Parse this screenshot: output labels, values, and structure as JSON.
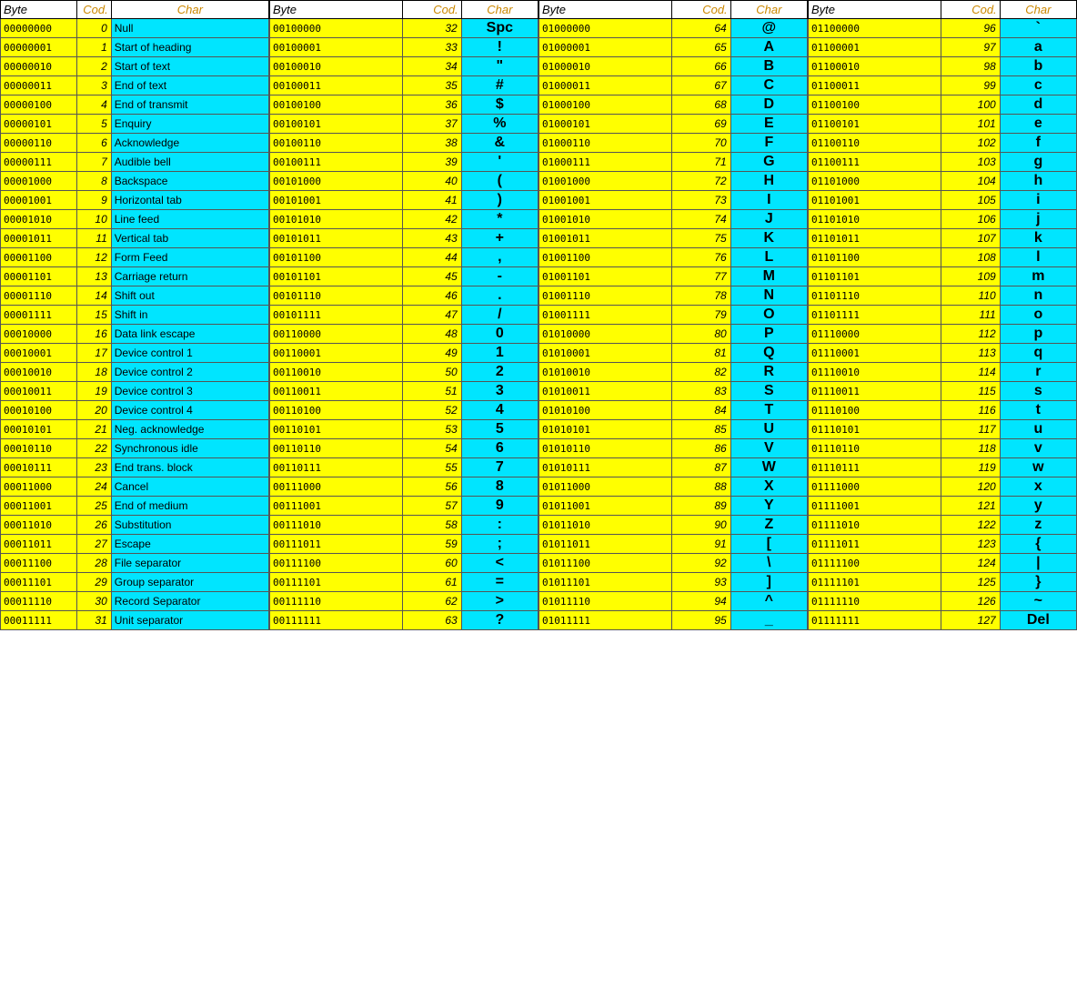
{
  "sections": [
    {
      "id": "section1",
      "headers": [
        "Byte",
        "Cod.",
        "Char"
      ],
      "rows": [
        {
          "byte": "00000000",
          "cod": "0",
          "char": "Null",
          "char_type": "desc"
        },
        {
          "byte": "00000001",
          "cod": "1",
          "char": "Start of heading",
          "char_type": "desc"
        },
        {
          "byte": "00000010",
          "cod": "2",
          "char": "Start of text",
          "char_type": "desc"
        },
        {
          "byte": "00000011",
          "cod": "3",
          "char": "End of text",
          "char_type": "desc"
        },
        {
          "byte": "00000100",
          "cod": "4",
          "char": "End of transmit",
          "char_type": "desc"
        },
        {
          "byte": "00000101",
          "cod": "5",
          "char": "Enquiry",
          "char_type": "desc"
        },
        {
          "byte": "00000110",
          "cod": "6",
          "char": "Acknowledge",
          "char_type": "desc"
        },
        {
          "byte": "00000111",
          "cod": "7",
          "char": "Audible bell",
          "char_type": "desc"
        },
        {
          "byte": "00001000",
          "cod": "8",
          "char": "Backspace",
          "char_type": "desc"
        },
        {
          "byte": "00001001",
          "cod": "9",
          "char": "Horizontal tab",
          "char_type": "desc"
        },
        {
          "byte": "00001010",
          "cod": "10",
          "char": "Line feed",
          "char_type": "desc"
        },
        {
          "byte": "00001011",
          "cod": "11",
          "char": "Vertical tab",
          "char_type": "desc"
        },
        {
          "byte": "00001100",
          "cod": "12",
          "char": "Form Feed",
          "char_type": "desc"
        },
        {
          "byte": "00001101",
          "cod": "13",
          "char": "Carriage return",
          "char_type": "desc"
        },
        {
          "byte": "00001110",
          "cod": "14",
          "char": "Shift out",
          "char_type": "desc"
        },
        {
          "byte": "00001111",
          "cod": "15",
          "char": "Shift in",
          "char_type": "desc"
        },
        {
          "byte": "00010000",
          "cod": "16",
          "char": "Data link escape",
          "char_type": "desc"
        },
        {
          "byte": "00010001",
          "cod": "17",
          "char": "Device control 1",
          "char_type": "desc"
        },
        {
          "byte": "00010010",
          "cod": "18",
          "char": "Device control 2",
          "char_type": "desc"
        },
        {
          "byte": "00010011",
          "cod": "19",
          "char": "Device control 3",
          "char_type": "desc"
        },
        {
          "byte": "00010100",
          "cod": "20",
          "char": "Device control 4",
          "char_type": "desc"
        },
        {
          "byte": "00010101",
          "cod": "21",
          "char": "Neg. acknowledge",
          "char_type": "desc"
        },
        {
          "byte": "00010110",
          "cod": "22",
          "char": "Synchronous idle",
          "char_type": "desc"
        },
        {
          "byte": "00010111",
          "cod": "23",
          "char": "End trans. block",
          "char_type": "desc"
        },
        {
          "byte": "00011000",
          "cod": "24",
          "char": "Cancel",
          "char_type": "desc"
        },
        {
          "byte": "00011001",
          "cod": "25",
          "char": "End of medium",
          "char_type": "desc"
        },
        {
          "byte": "00011010",
          "cod": "26",
          "char": "Substitution",
          "char_type": "desc"
        },
        {
          "byte": "00011011",
          "cod": "27",
          "char": "Escape",
          "char_type": "desc"
        },
        {
          "byte": "00011100",
          "cod": "28",
          "char": "File separator",
          "char_type": "desc"
        },
        {
          "byte": "00011101",
          "cod": "29",
          "char": "Group separator",
          "char_type": "desc"
        },
        {
          "byte": "00011110",
          "cod": "30",
          "char": "Record Separator",
          "char_type": "desc"
        },
        {
          "byte": "00011111",
          "cod": "31",
          "char": "Unit separator",
          "char_type": "desc"
        }
      ]
    },
    {
      "id": "section2",
      "headers": [
        "Byte",
        "Cod.",
        "Char"
      ],
      "rows": [
        {
          "byte": "00100000",
          "cod": "32",
          "char": "Spc",
          "char_type": "symbol"
        },
        {
          "byte": "00100001",
          "cod": "33",
          "char": "!",
          "char_type": "symbol"
        },
        {
          "byte": "00100010",
          "cod": "34",
          "char": "\"",
          "char_type": "symbol"
        },
        {
          "byte": "00100011",
          "cod": "35",
          "char": "#",
          "char_type": "symbol"
        },
        {
          "byte": "00100100",
          "cod": "36",
          "char": "$",
          "char_type": "symbol"
        },
        {
          "byte": "00100101",
          "cod": "37",
          "char": "%",
          "char_type": "symbol"
        },
        {
          "byte": "00100110",
          "cod": "38",
          "char": "&",
          "char_type": "symbol"
        },
        {
          "byte": "00100111",
          "cod": "39",
          "char": "'",
          "char_type": "symbol"
        },
        {
          "byte": "00101000",
          "cod": "40",
          "char": "(",
          "char_type": "symbol"
        },
        {
          "byte": "00101001",
          "cod": "41",
          "char": ")",
          "char_type": "symbol"
        },
        {
          "byte": "00101010",
          "cod": "42",
          "char": "*",
          "char_type": "symbol"
        },
        {
          "byte": "00101011",
          "cod": "43",
          "char": "+",
          "char_type": "symbol"
        },
        {
          "byte": "00101100",
          "cod": "44",
          "char": ",",
          "char_type": "symbol"
        },
        {
          "byte": "00101101",
          "cod": "45",
          "char": "-",
          "char_type": "symbol"
        },
        {
          "byte": "00101110",
          "cod": "46",
          "char": ".",
          "char_type": "symbol"
        },
        {
          "byte": "00101111",
          "cod": "47",
          "char": "/",
          "char_type": "symbol"
        },
        {
          "byte": "00110000",
          "cod": "48",
          "char": "0",
          "char_type": "symbol"
        },
        {
          "byte": "00110001",
          "cod": "49",
          "char": "1",
          "char_type": "symbol"
        },
        {
          "byte": "00110010",
          "cod": "50",
          "char": "2",
          "char_type": "symbol"
        },
        {
          "byte": "00110011",
          "cod": "51",
          "char": "3",
          "char_type": "symbol"
        },
        {
          "byte": "00110100",
          "cod": "52",
          "char": "4",
          "char_type": "symbol"
        },
        {
          "byte": "00110101",
          "cod": "53",
          "char": "5",
          "char_type": "symbol"
        },
        {
          "byte": "00110110",
          "cod": "54",
          "char": "6",
          "char_type": "symbol"
        },
        {
          "byte": "00110111",
          "cod": "55",
          "char": "7",
          "char_type": "symbol"
        },
        {
          "byte": "00111000",
          "cod": "56",
          "char": "8",
          "char_type": "symbol"
        },
        {
          "byte": "00111001",
          "cod": "57",
          "char": "9",
          "char_type": "symbol"
        },
        {
          "byte": "00111010",
          "cod": "58",
          "char": ":",
          "char_type": "symbol"
        },
        {
          "byte": "00111011",
          "cod": "59",
          "char": ";",
          "char_type": "symbol"
        },
        {
          "byte": "00111100",
          "cod": "60",
          "char": "<",
          "char_type": "symbol"
        },
        {
          "byte": "00111101",
          "cod": "61",
          "char": "=",
          "char_type": "symbol"
        },
        {
          "byte": "00111110",
          "cod": "62",
          "char": ">",
          "char_type": "symbol"
        },
        {
          "byte": "00111111",
          "cod": "63",
          "char": "?",
          "char_type": "symbol"
        }
      ]
    },
    {
      "id": "section3",
      "headers": [
        "Byte",
        "Cod.",
        "Char"
      ],
      "rows": [
        {
          "byte": "01000000",
          "cod": "64",
          "char": "@",
          "char_type": "symbol"
        },
        {
          "byte": "01000001",
          "cod": "65",
          "char": "A",
          "char_type": "symbol"
        },
        {
          "byte": "01000010",
          "cod": "66",
          "char": "B",
          "char_type": "symbol"
        },
        {
          "byte": "01000011",
          "cod": "67",
          "char": "C",
          "char_type": "symbol"
        },
        {
          "byte": "01000100",
          "cod": "68",
          "char": "D",
          "char_type": "symbol"
        },
        {
          "byte": "01000101",
          "cod": "69",
          "char": "E",
          "char_type": "symbol"
        },
        {
          "byte": "01000110",
          "cod": "70",
          "char": "F",
          "char_type": "symbol"
        },
        {
          "byte": "01000111",
          "cod": "71",
          "char": "G",
          "char_type": "symbol"
        },
        {
          "byte": "01001000",
          "cod": "72",
          "char": "H",
          "char_type": "symbol"
        },
        {
          "byte": "01001001",
          "cod": "73",
          "char": "I",
          "char_type": "symbol"
        },
        {
          "byte": "01001010",
          "cod": "74",
          "char": "J",
          "char_type": "symbol"
        },
        {
          "byte": "01001011",
          "cod": "75",
          "char": "K",
          "char_type": "symbol"
        },
        {
          "byte": "01001100",
          "cod": "76",
          "char": "L",
          "char_type": "symbol"
        },
        {
          "byte": "01001101",
          "cod": "77",
          "char": "M",
          "char_type": "symbol"
        },
        {
          "byte": "01001110",
          "cod": "78",
          "char": "N",
          "char_type": "symbol"
        },
        {
          "byte": "01001111",
          "cod": "79",
          "char": "O",
          "char_type": "symbol"
        },
        {
          "byte": "01010000",
          "cod": "80",
          "char": "P",
          "char_type": "symbol"
        },
        {
          "byte": "01010001",
          "cod": "81",
          "char": "Q",
          "char_type": "symbol"
        },
        {
          "byte": "01010010",
          "cod": "82",
          "char": "R",
          "char_type": "symbol"
        },
        {
          "byte": "01010011",
          "cod": "83",
          "char": "S",
          "char_type": "symbol"
        },
        {
          "byte": "01010100",
          "cod": "84",
          "char": "T",
          "char_type": "symbol"
        },
        {
          "byte": "01010101",
          "cod": "85",
          "char": "U",
          "char_type": "symbol"
        },
        {
          "byte": "01010110",
          "cod": "86",
          "char": "V",
          "char_type": "symbol"
        },
        {
          "byte": "01010111",
          "cod": "87",
          "char": "W",
          "char_type": "symbol"
        },
        {
          "byte": "01011000",
          "cod": "88",
          "char": "X",
          "char_type": "symbol"
        },
        {
          "byte": "01011001",
          "cod": "89",
          "char": "Y",
          "char_type": "symbol"
        },
        {
          "byte": "01011010",
          "cod": "90",
          "char": "Z",
          "char_type": "symbol"
        },
        {
          "byte": "01011011",
          "cod": "91",
          "char": "[",
          "char_type": "symbol"
        },
        {
          "byte": "01011100",
          "cod": "92",
          "char": "\\",
          "char_type": "symbol"
        },
        {
          "byte": "01011101",
          "cod": "93",
          "char": "]",
          "char_type": "symbol"
        },
        {
          "byte": "01011110",
          "cod": "94",
          "char": "^",
          "char_type": "symbol"
        },
        {
          "byte": "01011111",
          "cod": "95",
          "char": "_",
          "char_type": "symbol"
        }
      ]
    },
    {
      "id": "section4",
      "headers": [
        "Byte",
        "Cod.",
        "Char"
      ],
      "rows": [
        {
          "byte": "01100000",
          "cod": "96",
          "char": "`",
          "char_type": "symbol"
        },
        {
          "byte": "01100001",
          "cod": "97",
          "char": "a",
          "char_type": "symbol"
        },
        {
          "byte": "01100010",
          "cod": "98",
          "char": "b",
          "char_type": "symbol"
        },
        {
          "byte": "01100011",
          "cod": "99",
          "char": "c",
          "char_type": "symbol"
        },
        {
          "byte": "01100100",
          "cod": "100",
          "char": "d",
          "char_type": "symbol"
        },
        {
          "byte": "01100101",
          "cod": "101",
          "char": "e",
          "char_type": "symbol"
        },
        {
          "byte": "01100110",
          "cod": "102",
          "char": "f",
          "char_type": "symbol"
        },
        {
          "byte": "01100111",
          "cod": "103",
          "char": "g",
          "char_type": "symbol"
        },
        {
          "byte": "01101000",
          "cod": "104",
          "char": "h",
          "char_type": "symbol"
        },
        {
          "byte": "01101001",
          "cod": "105",
          "char": "i",
          "char_type": "symbol"
        },
        {
          "byte": "01101010",
          "cod": "106",
          "char": "j",
          "char_type": "symbol"
        },
        {
          "byte": "01101011",
          "cod": "107",
          "char": "k",
          "char_type": "symbol"
        },
        {
          "byte": "01101100",
          "cod": "108",
          "char": "l",
          "char_type": "symbol"
        },
        {
          "byte": "01101101",
          "cod": "109",
          "char": "m",
          "char_type": "symbol"
        },
        {
          "byte": "01101110",
          "cod": "110",
          "char": "n",
          "char_type": "symbol"
        },
        {
          "byte": "01101111",
          "cod": "111",
          "char": "o",
          "char_type": "symbol"
        },
        {
          "byte": "01110000",
          "cod": "112",
          "char": "p",
          "char_type": "symbol"
        },
        {
          "byte": "01110001",
          "cod": "113",
          "char": "q",
          "char_type": "symbol"
        },
        {
          "byte": "01110010",
          "cod": "114",
          "char": "r",
          "char_type": "symbol"
        },
        {
          "byte": "01110011",
          "cod": "115",
          "char": "s",
          "char_type": "symbol"
        },
        {
          "byte": "01110100",
          "cod": "116",
          "char": "t",
          "char_type": "symbol"
        },
        {
          "byte": "01110101",
          "cod": "117",
          "char": "u",
          "char_type": "symbol"
        },
        {
          "byte": "01110110",
          "cod": "118",
          "char": "v",
          "char_type": "symbol"
        },
        {
          "byte": "01110111",
          "cod": "119",
          "char": "w",
          "char_type": "symbol"
        },
        {
          "byte": "01111000",
          "cod": "120",
          "char": "x",
          "char_type": "symbol"
        },
        {
          "byte": "01111001",
          "cod": "121",
          "char": "y",
          "char_type": "symbol"
        },
        {
          "byte": "01111010",
          "cod": "122",
          "char": "z",
          "char_type": "symbol"
        },
        {
          "byte": "01111011",
          "cod": "123",
          "char": "{",
          "char_type": "symbol"
        },
        {
          "byte": "01111100",
          "cod": "124",
          "char": "|",
          "char_type": "symbol"
        },
        {
          "byte": "01111101",
          "cod": "125",
          "char": "}",
          "char_type": "symbol"
        },
        {
          "byte": "01111110",
          "cod": "126",
          "char": "~",
          "char_type": "symbol"
        },
        {
          "byte": "01111111",
          "cod": "127",
          "char": "Del",
          "char_type": "symbol"
        }
      ]
    }
  ]
}
